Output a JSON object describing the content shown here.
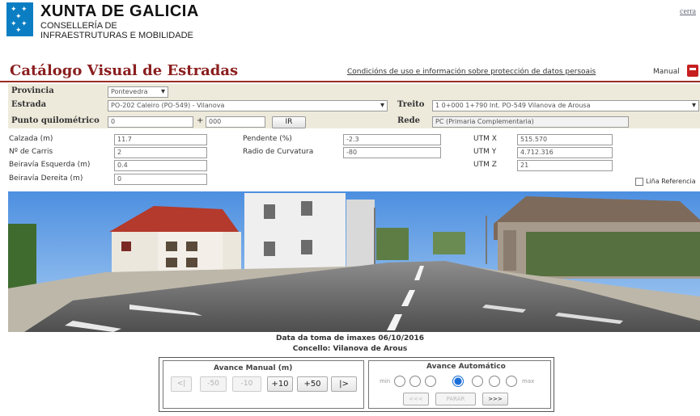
{
  "header": {
    "org_line1": "XUNTA DE GALICIA",
    "org_line2": "CONSELLERÍA DE",
    "org_line3": "INFRAESTRUTURAS E MOBILIDADE",
    "close_link": "cerra"
  },
  "title_bar": {
    "title": "Catálogo Visual de Estradas",
    "terms_link": "Condicións de uso e información sobre protección de datos persoais",
    "manual_link": "Manual"
  },
  "form": {
    "provincia_label": "Provincia",
    "provincia_value": "Pontevedra",
    "estrada_label": "Estrada",
    "estrada_value": "PO-202 Caleiro (PO-549) - Vilanova",
    "treito_label": "Treito",
    "treito_value": "1 0+000 1+790 Int. PO-549 Vilanova de Arousa",
    "pk_label": "Punto quilométrico",
    "pk_km": "0",
    "pk_plus": "+",
    "pk_m": "000",
    "ir_button": "IR",
    "rede_label": "Rede",
    "rede_value": "PC (Primaria Complementaria)"
  },
  "details": {
    "calzada_label": "Calzada (m)",
    "calzada_value": "11.7",
    "carris_label": "Nº de Carris",
    "carris_value": "2",
    "berma_esq_label": "Beiravía Esquerda (m)",
    "berma_esq_value": "0.4",
    "berma_der_label": "Beiravía Dereita (m)",
    "berma_der_value": "0",
    "pendente_label": "Pendente (%)",
    "pendente_value": "-2.3",
    "radio_label": "Radio de Curvatura",
    "radio_value": "-80",
    "utmx_label": "UTM X",
    "utmx_value": "515.570",
    "utmy_label": "UTM Y",
    "utmy_value": "4.712.316",
    "utmz_label": "UTM Z",
    "utmz_value": "21",
    "linea_ref_label": "Liña Referencia"
  },
  "photo_info": {
    "date_line": "Data da toma de imaxes 06/10/2016",
    "council_line": "Concello: Vilanova de Arous"
  },
  "manual_panel": {
    "title": "Avance Manual (m)",
    "buttons": [
      "<|",
      "-50",
      "-10",
      "+10",
      "+50",
      "|>"
    ]
  },
  "auto_panel": {
    "title": "Avance Automático",
    "min_label": "min",
    "max_label": "max",
    "selected_speed": 4,
    "speed_count": 7,
    "back_button": "<<<",
    "stop_button": "PARAR",
    "forward_button": ">>>"
  },
  "colors": {
    "brand_blue": "#0b7ec3",
    "title_red": "#8b1e1e",
    "form_beige": "#eeeadb",
    "radio_selected": "#1a6ed8"
  }
}
